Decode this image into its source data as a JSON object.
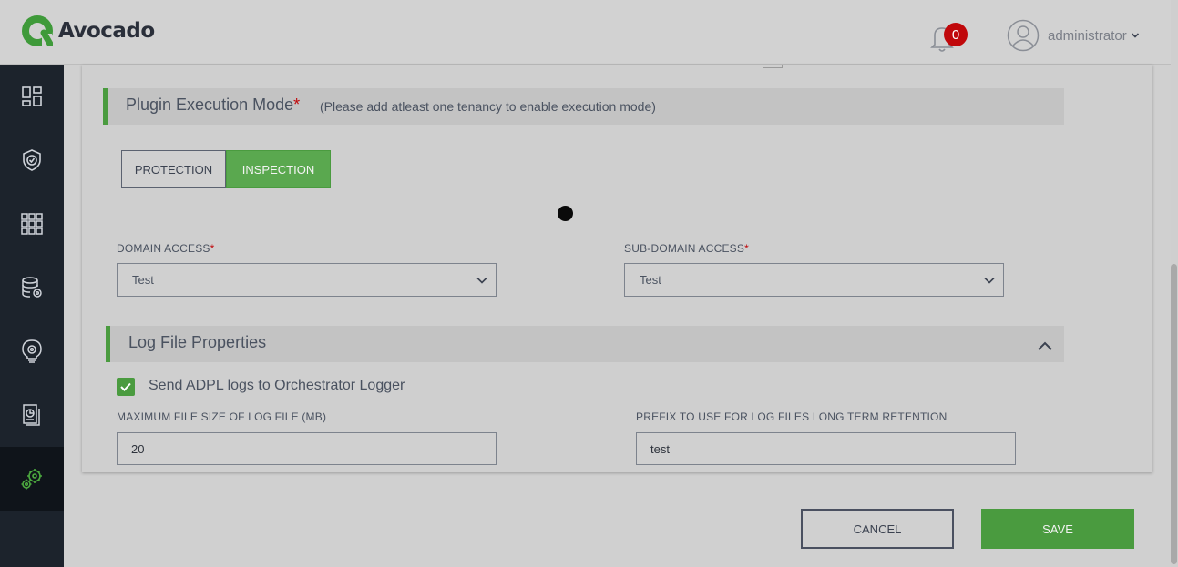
{
  "app": {
    "name": "Avocado"
  },
  "header": {
    "notifications": {
      "icon": "bell-icon",
      "count": "0"
    },
    "user": {
      "icon": "user-avatar-icon",
      "name": "administrator",
      "caret_icon": "chevron-down-icon"
    }
  },
  "sidebar": {
    "items": [
      {
        "icon": "dashboard-icon"
      },
      {
        "icon": "shield-check-icon"
      },
      {
        "icon": "apps-grid-icon"
      },
      {
        "icon": "database-settings-icon"
      },
      {
        "icon": "lightbulb-gear-icon"
      },
      {
        "icon": "report-icon"
      },
      {
        "icon": "settings-gears-icon",
        "active": true
      }
    ]
  },
  "plugin_execution": {
    "title": "Plugin Execution Mode",
    "required_mark": "*",
    "note": "(Please add atleast one tenancy to enable execution mode)",
    "modes": [
      {
        "label": "PROTECTION",
        "selected": false
      },
      {
        "label": "INSPECTION",
        "selected": true
      }
    ]
  },
  "domain_access": {
    "label": "DOMAIN ACCESS",
    "required_mark": "*",
    "value": "Test"
  },
  "subdomain_access": {
    "label": "SUB-DOMAIN ACCESS",
    "required_mark": "*",
    "value": "Test"
  },
  "log_file": {
    "title": "Log File Properties",
    "send_logs": {
      "label": "Send ADPL logs to Orchestrator Logger",
      "checked": true
    },
    "max_size": {
      "label": "MAXIMUM FILE SIZE OF LOG FILE (MB)",
      "value": "20"
    },
    "prefix": {
      "label": "PREFIX TO USE FOR LOG FILES LONG TERM RETENTION",
      "value": "test"
    }
  },
  "actions": {
    "cancel": "CANCEL",
    "save": "SAVE"
  },
  "colors": {
    "accent": "#4a9b3f",
    "sidebar": "#1c232c",
    "badge": "#c0080b"
  }
}
